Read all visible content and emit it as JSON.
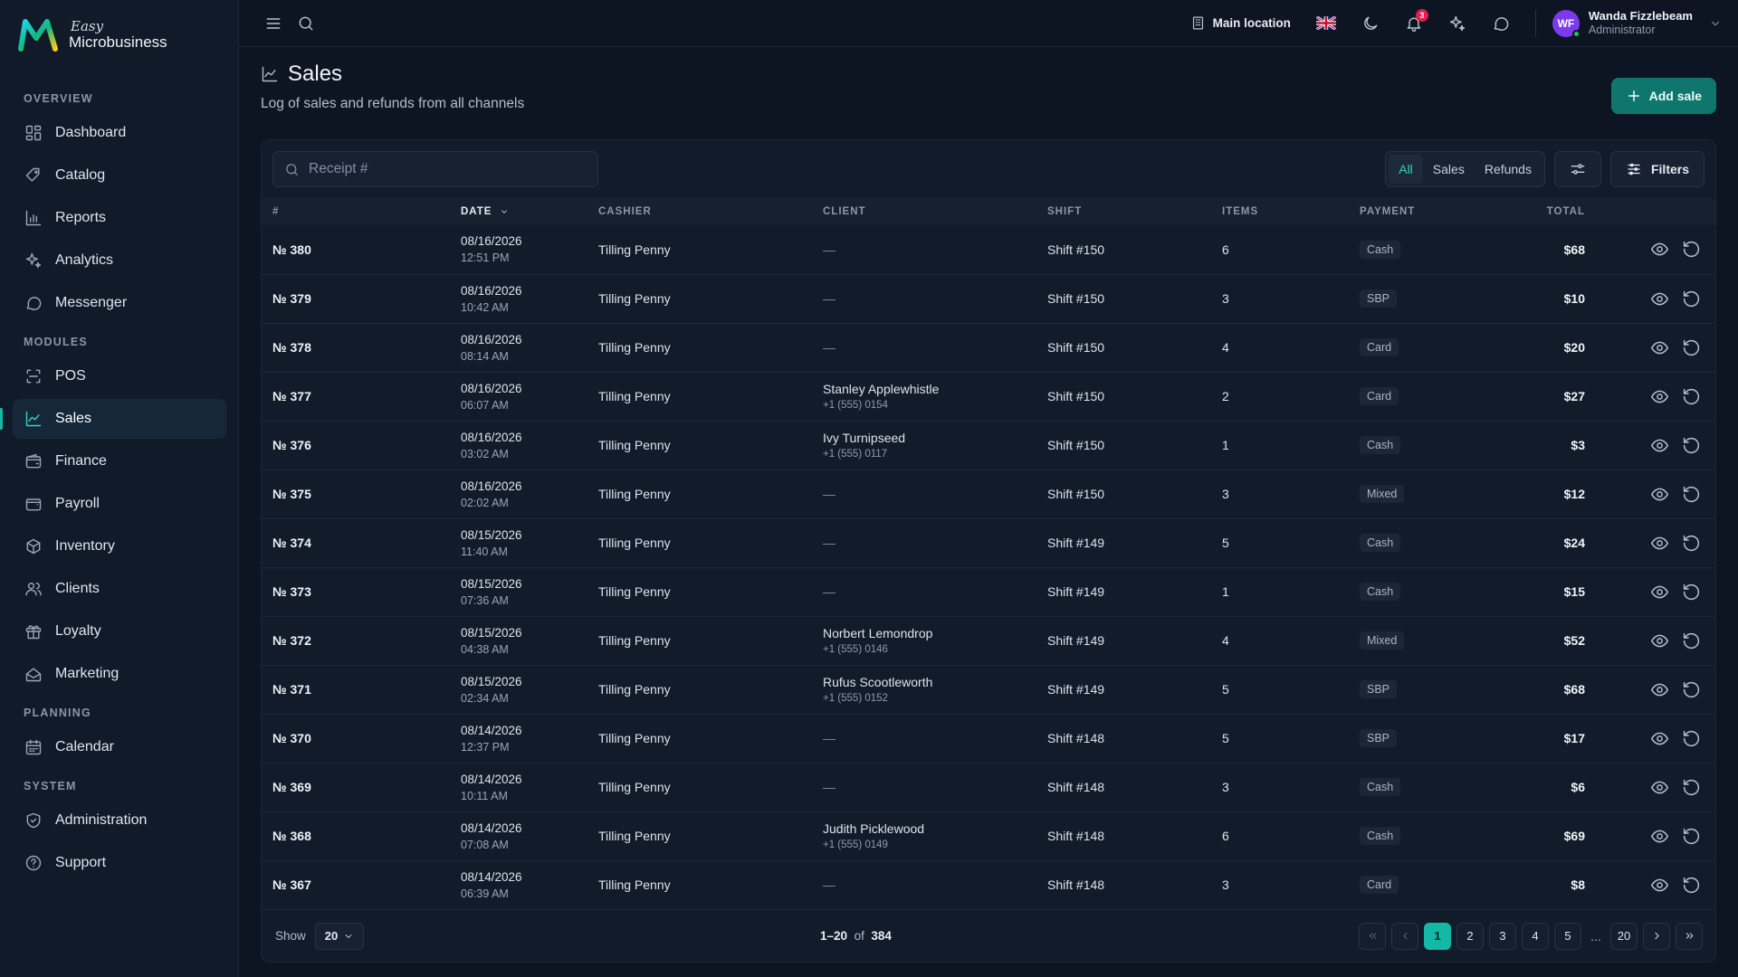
{
  "brand": {
    "top": "Easy",
    "bottom": "Microbusiness"
  },
  "sidebar": {
    "sections": [
      {
        "title": "OVERVIEW",
        "items": [
          {
            "label": "Dashboard",
            "icon": "dashboard-icon"
          },
          {
            "label": "Catalog",
            "icon": "catalog-icon"
          },
          {
            "label": "Reports",
            "icon": "reports-icon"
          },
          {
            "label": "Analytics",
            "icon": "analytics-icon"
          },
          {
            "label": "Messenger",
            "icon": "messenger-icon"
          }
        ]
      },
      {
        "title": "MODULES",
        "items": [
          {
            "label": "POS",
            "icon": "pos-icon"
          },
          {
            "label": "Sales",
            "icon": "sales-icon",
            "active": true
          },
          {
            "label": "Finance",
            "icon": "finance-icon"
          },
          {
            "label": "Payroll",
            "icon": "payroll-icon"
          },
          {
            "label": "Inventory",
            "icon": "inventory-icon"
          },
          {
            "label": "Clients",
            "icon": "clients-icon"
          },
          {
            "label": "Loyalty",
            "icon": "loyalty-icon"
          },
          {
            "label": "Marketing",
            "icon": "marketing-icon"
          }
        ]
      },
      {
        "title": "PLANNING",
        "items": [
          {
            "label": "Calendar",
            "icon": "calendar-icon"
          }
        ]
      },
      {
        "title": "SYSTEM",
        "items": [
          {
            "label": "Administration",
            "icon": "administration-icon"
          },
          {
            "label": "Support",
            "icon": "support-icon"
          }
        ]
      }
    ]
  },
  "topbar": {
    "location": "Main location",
    "notifications_count": "3",
    "user": {
      "initials": "WF",
      "name": "Wanda Fizzlebeam",
      "role": "Administrator"
    }
  },
  "page": {
    "title": "Sales",
    "subtitle": "Log of sales and refunds from all channels",
    "add_label": "Add sale"
  },
  "toolbar": {
    "search_placeholder": "Receipt #",
    "segments": [
      {
        "label": "All",
        "active": true
      },
      {
        "label": "Sales"
      },
      {
        "label": "Refunds"
      }
    ],
    "filters_label": "Filters"
  },
  "table": {
    "columns": [
      "#",
      "DATE",
      "CASHIER",
      "CLIENT",
      "SHIFT",
      "ITEMS",
      "PAYMENT",
      "TOTAL"
    ],
    "rows": [
      {
        "num": "№ 380",
        "date": "08/16/2026",
        "time": "12:51 PM",
        "cashier": "Tilling Penny",
        "client": "",
        "phone": "",
        "shift": "Shift #150",
        "items": "6",
        "payment": "Cash",
        "total": "$68"
      },
      {
        "num": "№ 379",
        "date": "08/16/2026",
        "time": "10:42 AM",
        "cashier": "Tilling Penny",
        "client": "",
        "phone": "",
        "shift": "Shift #150",
        "items": "3",
        "payment": "SBP",
        "total": "$10"
      },
      {
        "num": "№ 378",
        "date": "08/16/2026",
        "time": "08:14 AM",
        "cashier": "Tilling Penny",
        "client": "",
        "phone": "",
        "shift": "Shift #150",
        "items": "4",
        "payment": "Card",
        "total": "$20"
      },
      {
        "num": "№ 377",
        "date": "08/16/2026",
        "time": "06:07 AM",
        "cashier": "Tilling Penny",
        "client": "Stanley Applewhistle",
        "phone": "+1 (555) 0154",
        "shift": "Shift #150",
        "items": "2",
        "payment": "Card",
        "total": "$27"
      },
      {
        "num": "№ 376",
        "date": "08/16/2026",
        "time": "03:02 AM",
        "cashier": "Tilling Penny",
        "client": "Ivy Turnipseed",
        "phone": "+1 (555) 0117",
        "shift": "Shift #150",
        "items": "1",
        "payment": "Cash",
        "total": "$3"
      },
      {
        "num": "№ 375",
        "date": "08/16/2026",
        "time": "02:02 AM",
        "cashier": "Tilling Penny",
        "client": "",
        "phone": "",
        "shift": "Shift #150",
        "items": "3",
        "payment": "Mixed",
        "total": "$12"
      },
      {
        "num": "№ 374",
        "date": "08/15/2026",
        "time": "11:40 AM",
        "cashier": "Tilling Penny",
        "client": "",
        "phone": "",
        "shift": "Shift #149",
        "items": "5",
        "payment": "Cash",
        "total": "$24"
      },
      {
        "num": "№ 373",
        "date": "08/15/2026",
        "time": "07:36 AM",
        "cashier": "Tilling Penny",
        "client": "",
        "phone": "",
        "shift": "Shift #149",
        "items": "1",
        "payment": "Cash",
        "total": "$15"
      },
      {
        "num": "№ 372",
        "date": "08/15/2026",
        "time": "04:38 AM",
        "cashier": "Tilling Penny",
        "client": "Norbert Lemondrop",
        "phone": "+1 (555) 0146",
        "shift": "Shift #149",
        "items": "4",
        "payment": "Mixed",
        "total": "$52"
      },
      {
        "num": "№ 371",
        "date": "08/15/2026",
        "time": "02:34 AM",
        "cashier": "Tilling Penny",
        "client": "Rufus Scootleworth",
        "phone": "+1 (555) 0152",
        "shift": "Shift #149",
        "items": "5",
        "payment": "SBP",
        "total": "$68"
      },
      {
        "num": "№ 370",
        "date": "08/14/2026",
        "time": "12:37 PM",
        "cashier": "Tilling Penny",
        "client": "",
        "phone": "",
        "shift": "Shift #148",
        "items": "5",
        "payment": "SBP",
        "total": "$17"
      },
      {
        "num": "№ 369",
        "date": "08/14/2026",
        "time": "10:11 AM",
        "cashier": "Tilling Penny",
        "client": "",
        "phone": "",
        "shift": "Shift #148",
        "items": "3",
        "payment": "Cash",
        "total": "$6"
      },
      {
        "num": "№ 368",
        "date": "08/14/2026",
        "time": "07:08 AM",
        "cashier": "Tilling Penny",
        "client": "Judith Picklewood",
        "phone": "+1 (555) 0149",
        "shift": "Shift #148",
        "items": "6",
        "payment": "Cash",
        "total": "$69"
      },
      {
        "num": "№ 367",
        "date": "08/14/2026",
        "time": "06:39 AM",
        "cashier": "Tilling Penny",
        "client": "",
        "phone": "",
        "shift": "Shift #148",
        "items": "3",
        "payment": "Card",
        "total": "$8"
      }
    ],
    "empty_client": "—"
  },
  "footer": {
    "show_label": "Show",
    "page_size": "20",
    "range": "1–20",
    "of_label": "of",
    "total_count": "384",
    "pages": [
      "1",
      "2",
      "3",
      "4",
      "5"
    ],
    "ellipsis": "...",
    "last_page": "20",
    "current_page": "1"
  },
  "colors": {
    "accent": "#14b8a6",
    "add_button": "#0f766e",
    "background": "#0d1522",
    "sidebar": "#111a28",
    "avatar": "#7c3aed"
  }
}
